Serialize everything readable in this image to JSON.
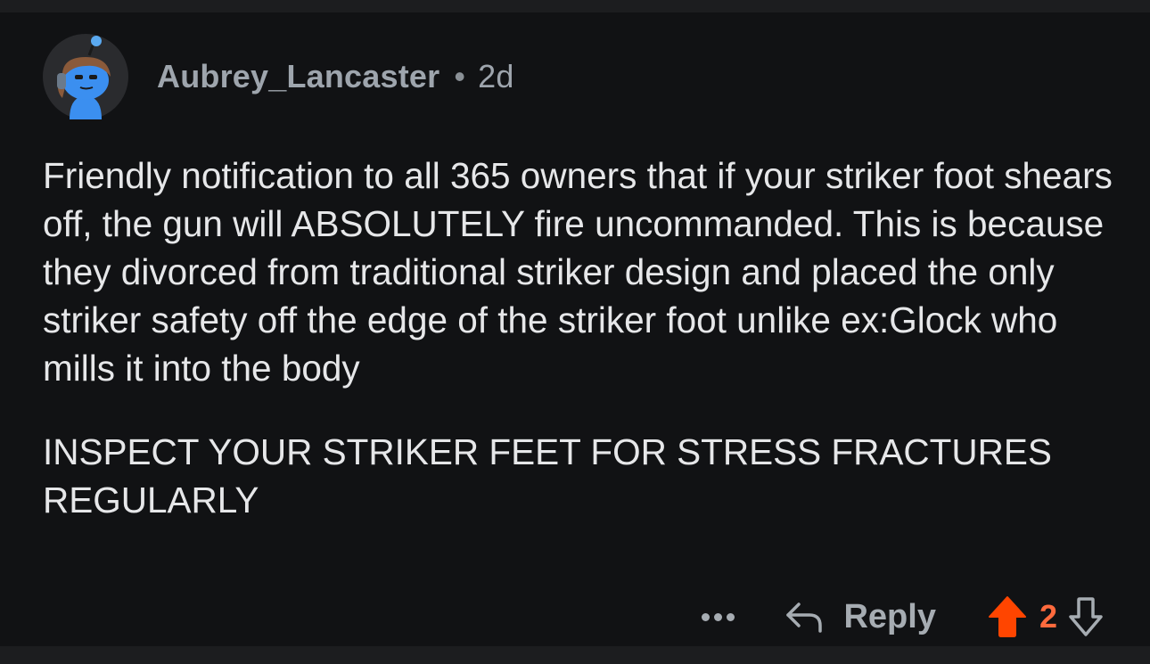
{
  "comment": {
    "author": "Aubrey_Lancaster",
    "separator": "•",
    "age": "2d",
    "avatar_icon": "snoo-avatar-icon",
    "paragraphs": [
      "Friendly notification to all 365 owners that if your striker foot shears off, the gun will ABSOLUTELY fire uncommanded. This is because they divorced from traditional striker design and placed the only striker safety off the edge of the striker foot unlike ex:Glock who mills it into the body",
      "INSPECT YOUR STRIKER FEET FOR STRESS FRACTURES REGULARLY"
    ]
  },
  "actions": {
    "more_icon": "more-options-icon",
    "reply_label": "Reply",
    "reply_icon": "reply-arrow-icon",
    "upvote_icon": "upvote-arrow-icon",
    "score": "2",
    "downvote_icon": "downvote-arrow-icon"
  },
  "colors": {
    "background": "#111214",
    "text": "#e6e7e9",
    "muted": "#a6acb2",
    "upvote_active": "#ff4500",
    "score": "#ff6a3d"
  }
}
